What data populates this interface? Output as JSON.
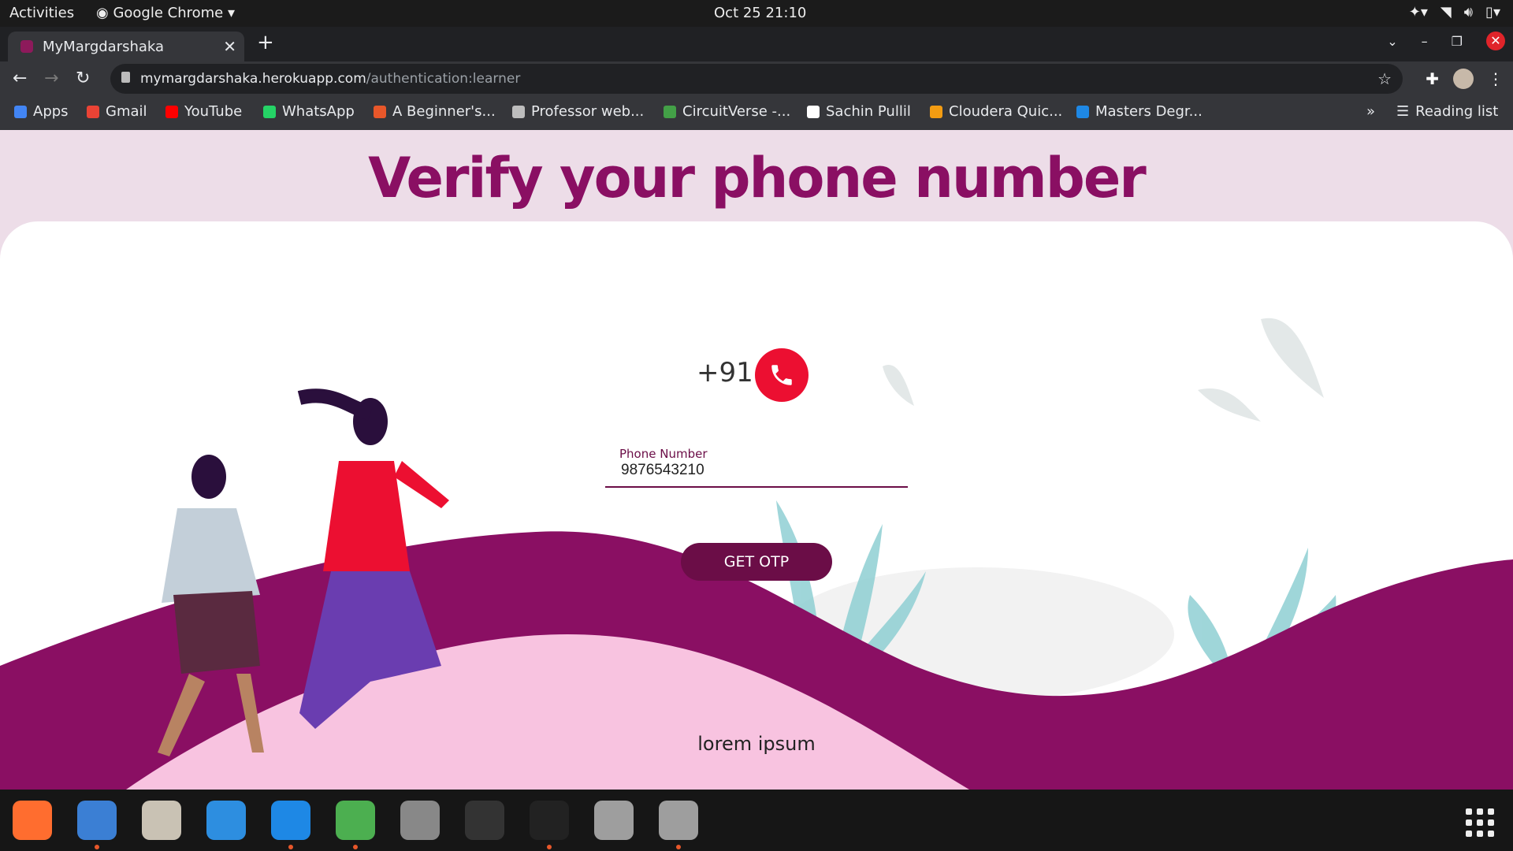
{
  "system_bar": {
    "activities": "Activities",
    "app_name": "Google Chrome",
    "clock": "Oct 25  21:10"
  },
  "browser": {
    "tab_title": "MyMargdarshaka",
    "url_host": "mymargdarshaka.herokuapp.com",
    "url_path": "/authentication:learner",
    "bookmarks": [
      {
        "label": "Apps",
        "color": "#4285f4"
      },
      {
        "label": "Gmail",
        "color": "#ea4335"
      },
      {
        "label": "YouTube",
        "color": "#ff0000"
      },
      {
        "label": "WhatsApp",
        "color": "#25d366"
      },
      {
        "label": "A Beginner's...",
        "color": "#e8572a"
      },
      {
        "label": "Professor web...",
        "color": "#bdbdbd"
      },
      {
        "label": "CircuitVerse -...",
        "color": "#43a047"
      },
      {
        "label": "Sachin Pullil",
        "color": "#ffffff"
      },
      {
        "label": "Cloudera Quic...",
        "color": "#f39c12"
      },
      {
        "label": "Masters Degr...",
        "color": "#1e88e5"
      }
    ],
    "more_bookmarks": "»",
    "reading_list": "Reading list"
  },
  "page": {
    "heading": "Verify your phone number",
    "country_code": "+91",
    "phone_label": "Phone Number",
    "phone_value": "9876543210",
    "button_label": "GET OTP",
    "footer_text": "lorem ipsum"
  },
  "colors": {
    "brand": "#8a0f63",
    "button": "#6b0d47",
    "phone_icon": "#ec0f31",
    "wave_dark": "#8a0f63",
    "wave_light": "#f8c3e0"
  },
  "dock": {
    "apps": [
      {
        "name": "firefox",
        "color": "#ff6d2f",
        "running": false
      },
      {
        "name": "text-editor",
        "color": "#3b7fd4",
        "running": true
      },
      {
        "name": "files",
        "color": "#c9c2b4",
        "running": false
      },
      {
        "name": "help",
        "color": "#2d8ee0",
        "running": false
      },
      {
        "name": "vscode",
        "color": "#1e88e5",
        "running": true
      },
      {
        "name": "chrome",
        "color": "#4caf50",
        "running": true
      },
      {
        "name": "settings",
        "color": "#888888",
        "running": false
      },
      {
        "name": "terminal",
        "color": "#333333",
        "running": false
      },
      {
        "name": "figma",
        "color": "#222222",
        "running": true
      },
      {
        "name": "ssd-drive",
        "color": "#9e9e9e",
        "running": false
      },
      {
        "name": "ssd-drive-2",
        "color": "#9e9e9e",
        "running": true
      }
    ]
  }
}
